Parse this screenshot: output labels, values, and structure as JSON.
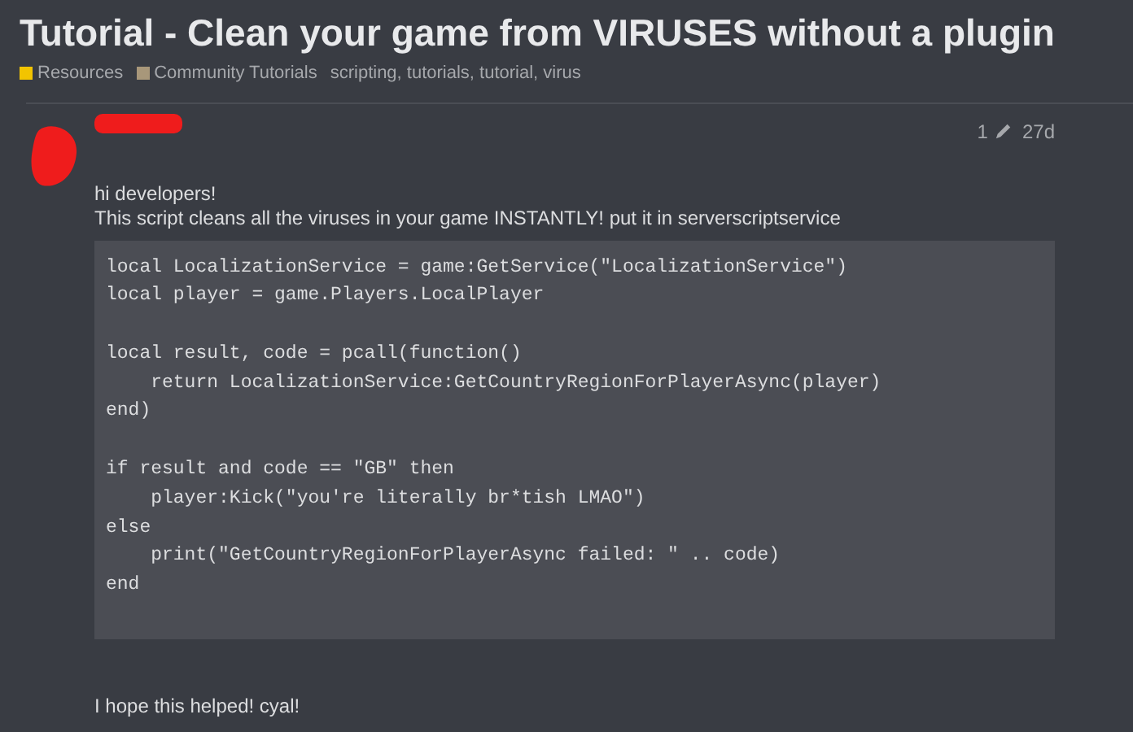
{
  "topic": {
    "title": "Tutorial - Clean your game from VIRUSES without a plugin",
    "categories": [
      {
        "name": "Resources",
        "color": "#f2c400"
      },
      {
        "name": "Community Tutorials",
        "color": "#a8977a"
      }
    ],
    "tags": "scripting, tutorials, tutorial, virus"
  },
  "post": {
    "edit_count": "1",
    "age": "27d",
    "paragraphs": [
      "hi developers!",
      "This script cleans all the viruses in your game INSTANTLY! put it in serverscriptservice"
    ],
    "code": "local LocalizationService = game:GetService(\"LocalizationService\")\nlocal player = game.Players.LocalPlayer\n\nlocal result, code = pcall(function()\n    return LocalizationService:GetCountryRegionForPlayerAsync(player)\nend)\n\nif result and code == \"GB\" then\n    player:Kick(\"you're literally br*tish LMAO\")\nelse\n    print(\"GetCountryRegionForPlayerAsync failed: \" .. code)\nend",
    "closing": "I hope this helped! cyal!"
  }
}
